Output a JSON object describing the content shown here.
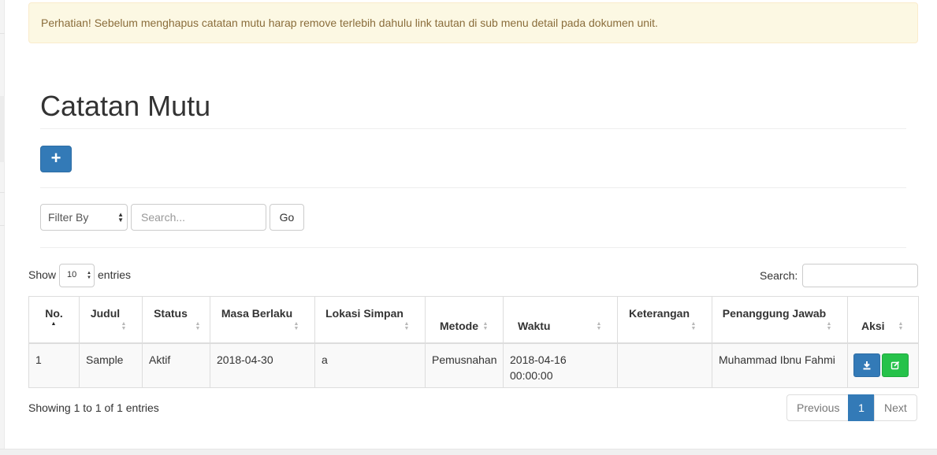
{
  "alert": {
    "text": "Perhatian! Sebelum menghapus catatan mutu harap remove terlebih dahulu link tautan di sub menu detail pada dokumen unit."
  },
  "page": {
    "title": "Catatan Mutu"
  },
  "toolbar": {
    "add_label": "+"
  },
  "filter": {
    "select_value": "Filter By",
    "search_placeholder": "Search...",
    "go_label": "Go"
  },
  "table_controls": {
    "show_label": "Show",
    "entries_value": "10",
    "entries_label": "entries",
    "search_label": "Search:"
  },
  "table": {
    "columns": [
      "No.",
      "Judul",
      "Status",
      "Masa Berlaku",
      "Lokasi Simpan",
      "Metode",
      "Waktu",
      "Keterangan",
      "Penanggung Jawab",
      "Aksi"
    ],
    "rows": [
      {
        "no": "1",
        "judul": "Sample",
        "status": "Aktif",
        "masa_berlaku": "2018-04-30",
        "lokasi_simpan": "a",
        "metode": "Pemusnahan",
        "waktu_date": "2018-04-16",
        "waktu_time": "00:00:00",
        "keterangan": "",
        "penanggung_jawab": "Muhammad Ibnu Fahmi"
      }
    ]
  },
  "footer": {
    "info": "Showing 1 to 1 of 1 entries",
    "pagination": {
      "previous": "Previous",
      "current": "1",
      "next": "Next"
    }
  },
  "colors": {
    "primary": "#337ab7",
    "success": "#26c24a",
    "alert_bg": "#fcf8e3",
    "alert_text": "#8a6d3b"
  },
  "icons": {
    "add": "plus-icon",
    "download": "download-icon",
    "edit": "edit-icon",
    "sort": "sort-icon"
  }
}
